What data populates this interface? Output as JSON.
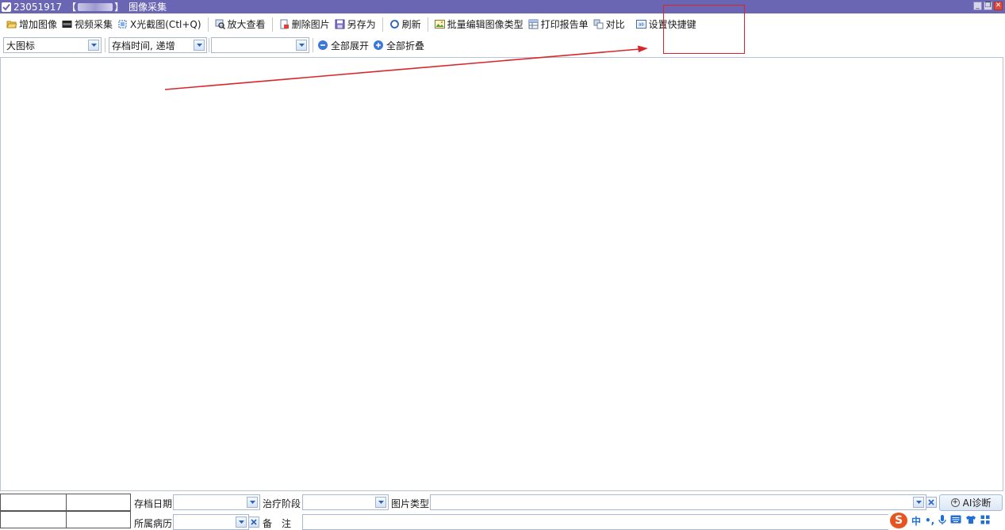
{
  "window": {
    "id": "23051917",
    "bracket_open": "【",
    "bracket_close": "】",
    "title": "图像采集",
    "min": "_",
    "max": "❐",
    "close": "✕"
  },
  "toolbar": {
    "add_image": "增加图像",
    "video_capture": "视频采集",
    "xray_capture": "X光截图(Ctl+Q)",
    "zoom_view": "放大查看",
    "delete_image": "删除图片",
    "save_as": "另存为",
    "refresh": "刷新",
    "batch_edit_type": "批量编辑图像类型",
    "print_report": "打印报告单",
    "compare": "对比",
    "set_shortcut": "设置快捷键"
  },
  "filters": {
    "view_mode": "大图标",
    "sort_order": "存档时间, 递增",
    "category": "",
    "expand_all": "全部展开",
    "collapse_all": "全部折叠"
  },
  "form": {
    "archive_date_label": "存档日期",
    "archive_date_value": "",
    "treatment_stage_label": "治疗阶段",
    "treatment_stage_value": "",
    "image_type_label": "图片类型",
    "image_type_value": "",
    "case_label": "所属病历",
    "case_value": "",
    "remark_label": "备　注",
    "remark_value": "",
    "ai_button": "AI诊断"
  },
  "ime": {
    "logo": "S",
    "lang": "中",
    "punct": "•,"
  },
  "colors": {
    "titlebar": "#6b66b3",
    "annotation": "#d9262b",
    "ime_logo": "#e8541f"
  }
}
